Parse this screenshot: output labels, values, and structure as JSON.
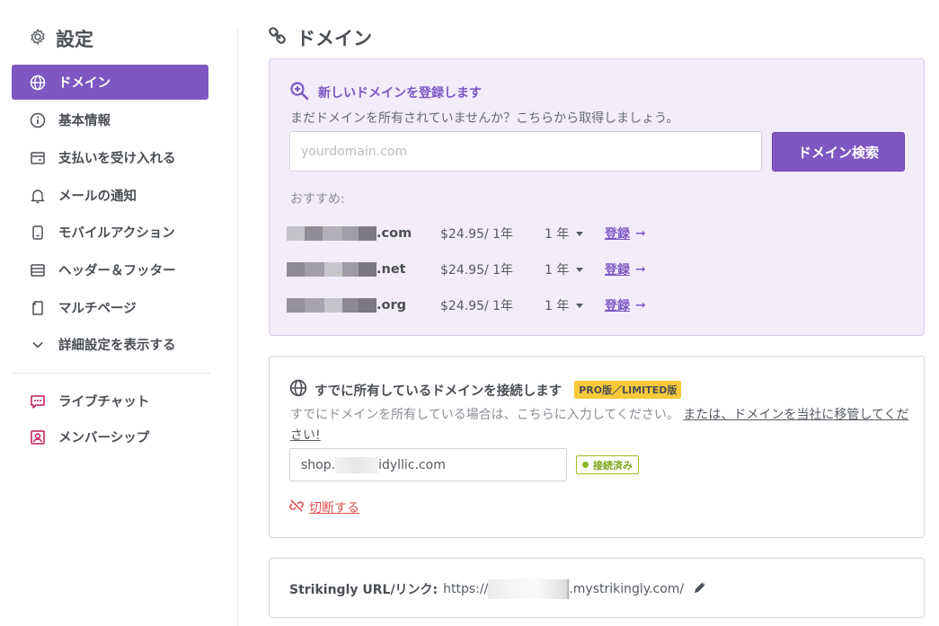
{
  "sidebar": {
    "title": "設定",
    "items": [
      {
        "label": "ドメイン",
        "icon": "globe-icon"
      },
      {
        "label": "基本情報",
        "icon": "info-icon"
      },
      {
        "label": "支払いを受け入れる",
        "icon": "card-icon"
      },
      {
        "label": "メールの通知",
        "icon": "bell-icon"
      },
      {
        "label": "モバイルアクション",
        "icon": "mobile-icon"
      },
      {
        "label": "ヘッダー＆フッター",
        "icon": "layout-icon"
      },
      {
        "label": "マルチページ",
        "icon": "pages-icon"
      },
      {
        "label": "詳細設定を表示する",
        "icon": "chevron-down-icon"
      },
      {
        "label": "ライブチャット",
        "icon": "chat-icon"
      },
      {
        "label": "メンバーシップ",
        "icon": "member-icon"
      }
    ]
  },
  "main": {
    "title": "ドメイン"
  },
  "register": {
    "heading": "新しいドメインを登録します",
    "subtitle": "まだドメインを所有されていませんか？こちらから取得しましょう。",
    "placeholder": "yourdomain.com",
    "search_button": "ドメイン検索",
    "recommend_label": "おすすめ:",
    "suggestions": [
      {
        "tld": ".com",
        "price": "$24.95/ 1年",
        "term": "1 年",
        "action": "登録"
      },
      {
        "tld": ".net",
        "price": "$24.95/ 1年",
        "term": "1 年",
        "action": "登録"
      },
      {
        "tld": ".org",
        "price": "$24.95/ 1年",
        "term": "1 年",
        "action": "登録"
      }
    ]
  },
  "connect": {
    "heading": "すでに所有しているドメインを接続します",
    "badge": "PRO版／LIMITED版",
    "subtitle": "すでにドメインを所有している場合は、こちらに入力してください。",
    "transfer_link": "または、ドメインを当社に移管してください!",
    "domain_prefix": "shop.",
    "domain_suffix": "idyllic.com",
    "status": "接続済み",
    "disconnect": "切断する"
  },
  "url": {
    "label": "Strikingly URL/リンク:",
    "prefix": "https://",
    "suffix": ".mystrikingly.com/"
  },
  "colors": {
    "accent": "#7e57c2",
    "connected": "#8ab81f",
    "danger": "#e05252",
    "badge": "#f8c93a"
  }
}
